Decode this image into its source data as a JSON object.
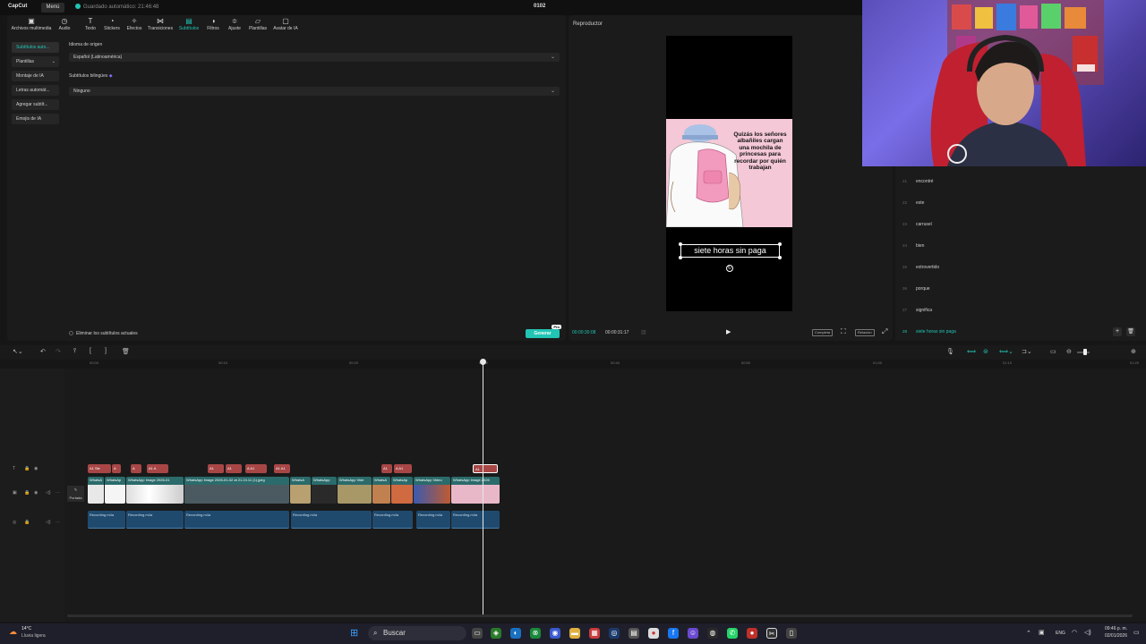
{
  "titlebar": {
    "logo": "CapCut",
    "menu": "Menú",
    "autosave": "Guardado automático: 21:46:48",
    "project": "0102"
  },
  "toolbar": [
    {
      "label": "Archivos multimedia",
      "icon": "media-icon"
    },
    {
      "label": "Audio",
      "icon": "audio-icon"
    },
    {
      "label": "Texto",
      "icon": "text-icon"
    },
    {
      "label": "Stickers",
      "icon": "stickers-icon"
    },
    {
      "label": "Efectos",
      "icon": "effects-icon"
    },
    {
      "label": "Transiciones",
      "icon": "transitions-icon"
    },
    {
      "label": "Subtítulos",
      "icon": "subtitles-icon"
    },
    {
      "label": "Filtros",
      "icon": "filters-icon"
    },
    {
      "label": "Ajuste",
      "icon": "adjust-icon"
    },
    {
      "label": "Plantillas",
      "icon": "templates-icon"
    },
    {
      "label": "Avatar de IA",
      "icon": "avatar-icon"
    }
  ],
  "subnav": [
    "Subtítulos auto...",
    "Plantillas",
    "Montaje de IA",
    "Letras automát...",
    "Agregar subtít...",
    "Emojis de IA"
  ],
  "settings": {
    "source_lang_label": "Idioma de origen",
    "source_lang_value": "Español (Latinoamérica)",
    "bilingual_label": "Subtítulos bilingües",
    "bilingual_value": "Ninguno",
    "remove_current": "Eliminar los subtítulos actuales",
    "generate": "Generar",
    "pro_badge": "Pro"
  },
  "player": {
    "title": "Reproductor",
    "meme_text": "Quizás los señores albañiles cargan una mochila de princesas para recordar por quién trabajan",
    "caption": "siete horas sin paga",
    "time_current": "00:00:30:08",
    "time_total": "00:00:31:17",
    "btn_full": "Completa",
    "btn_ratio": "Relación"
  },
  "subtitles": [
    {
      "num": "21",
      "text": "encontré"
    },
    {
      "num": "22",
      "text": "este"
    },
    {
      "num": "23",
      "text": "carrusel"
    },
    {
      "num": "24",
      "text": "bien"
    },
    {
      "num": "25",
      "text": "extrovertido"
    },
    {
      "num": "26",
      "text": "porque"
    },
    {
      "num": "27",
      "text": "significa"
    },
    {
      "num": "28",
      "text": "siete horas sin paga"
    }
  ],
  "ruler": [
    "00:00",
    "00:10",
    "00:20",
    "00:30",
    "00:40",
    "00:50",
    "01:00",
    "01:10",
    "01:20"
  ],
  "tracks": {
    "text_clips": [
      "A1 Sie",
      "A",
      "A",
      "A1 A",
      "A1",
      "A1",
      "A A1",
      "A1 A1",
      "A1",
      "A A1",
      "A1"
    ],
    "video_clips": [
      "WhatsA",
      "WhatsAp",
      "WhatsApp Image 2026-01",
      "WhatsApp Image 2026-01-02 at 21.24.11 (1).jpeg",
      "WhatsA",
      "WhatsApp",
      "WhatsApp Vide",
      "WhatsA",
      "WhatsAp",
      "WhatsApp Video",
      "WhatsApp Image 2026"
    ],
    "audio_clips": [
      "Recording.m4a",
      "Recording.m4a",
      "Recording.m4a",
      "Recording.m4a",
      "Recording.m4a",
      "Recording.m4a",
      "Recording.m4a"
    ],
    "cover": "Portada"
  },
  "taskbar": {
    "temp": "14°C",
    "weather": "Lluvia ligera",
    "search": "Buscar",
    "lang": "ENG",
    "time": "09:46 p. m.",
    "date": "02/01/2026"
  },
  "colors": {
    "accent": "#22c4b4",
    "text_clip": "#a84646",
    "video_clip": "#2b6b6b",
    "audio_clip": "#1f4a6e"
  }
}
